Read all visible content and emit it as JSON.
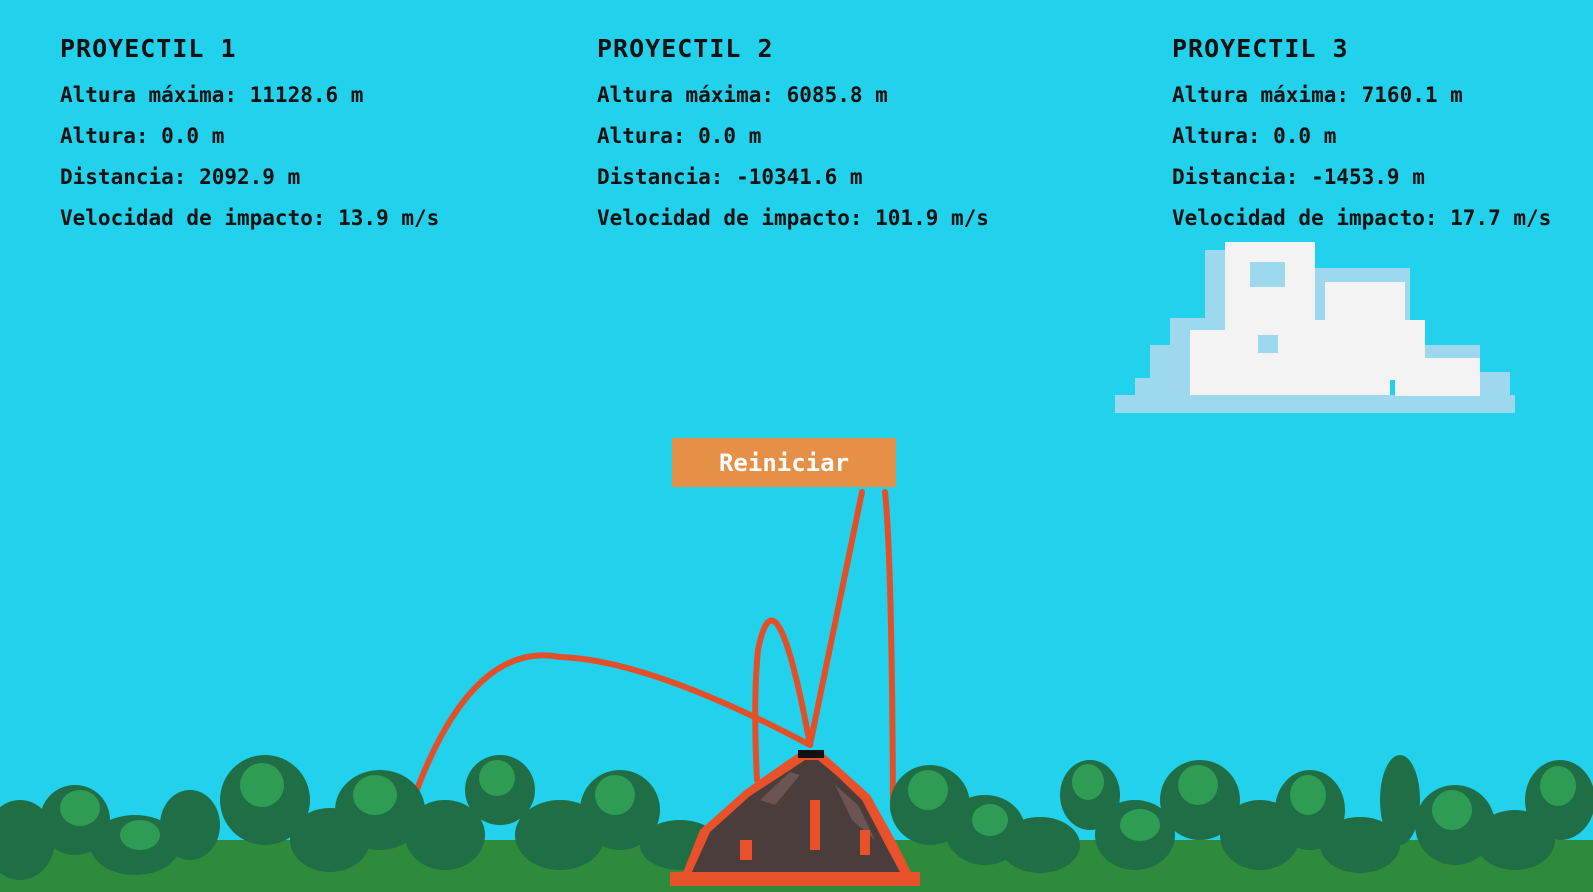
{
  "projectiles": [
    {
      "title": "PROYECTIL 1",
      "max_height": "Altura máxima: 11128.6 m",
      "height": "Altura: 0.0 m",
      "distance": "Distancia: 2092.9 m",
      "impact_speed": "Velocidad de impacto: 13.9 m/s"
    },
    {
      "title": "PROYECTIL 2",
      "max_height": "Altura máxima: 6085.8 m",
      "height": "Altura: 0.0 m",
      "distance": "Distancia: -10341.6 m",
      "impact_speed": "Velocidad de impacto: 101.9 m/s"
    },
    {
      "title": "PROYECTIL 3",
      "max_height": "Altura máxima: 7160.1 m",
      "height": "Altura: 0.0 m",
      "distance": "Distancia: -1453.9 m",
      "impact_speed": "Velocidad de impacto: 17.7 m/s"
    }
  ],
  "reset_label": "Reiniciar",
  "colors": {
    "sky": "#22d1ec",
    "trajectory": "#e2502a",
    "button": "#e68f47",
    "tree_dark": "#1f6e45",
    "tree_light": "#2e9c52",
    "ground": "#2f8b3c",
    "volcano": "#4b3d3b",
    "lava": "#e8512a"
  }
}
